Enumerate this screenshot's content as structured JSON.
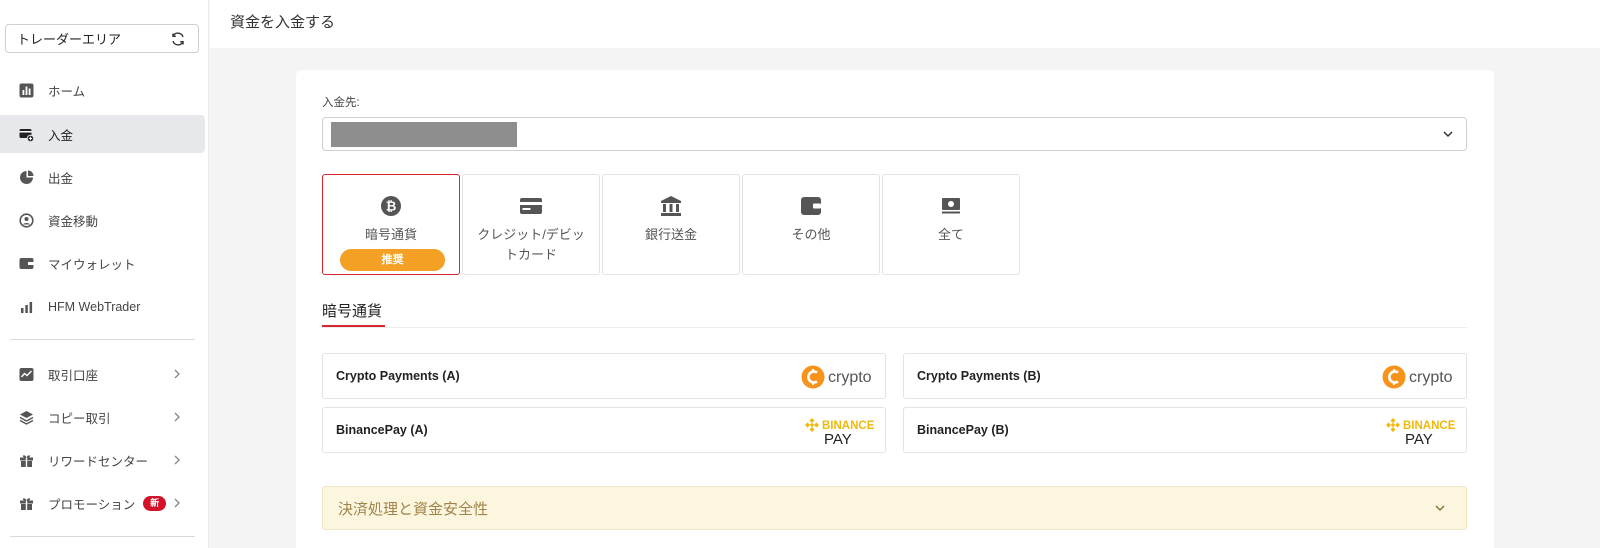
{
  "sidebar": {
    "area_select": "トレーダーエリア",
    "items": [
      {
        "label": "ホーム",
        "icon": "chart-icon"
      },
      {
        "label": "入金",
        "icon": "deposit-icon"
      },
      {
        "label": "出金",
        "icon": "withdraw-icon"
      },
      {
        "label": "資金移動",
        "icon": "transfer-icon"
      },
      {
        "label": "マイウォレット",
        "icon": "wallet-icon"
      },
      {
        "label": "HFM WebTrader",
        "icon": "bar-chart-icon"
      }
    ],
    "items2": [
      {
        "label": "取引口座",
        "icon": "trading-chart-icon"
      },
      {
        "label": "コピー取引",
        "icon": "layers-icon"
      },
      {
        "label": "リワードセンター",
        "icon": "gift-icon"
      },
      {
        "label": "プロモーション",
        "icon": "gift-icon",
        "badge": "新"
      }
    ]
  },
  "header": {
    "title": "資金を入金する"
  },
  "main": {
    "dest_label": "入金先:",
    "methods": [
      {
        "label": "暗号通貨",
        "icon": "bitcoin-icon",
        "badge": "推奨"
      },
      {
        "label": "クレジット/デビッ\nトカード",
        "icon": "credit-card-icon"
      },
      {
        "label": "銀行送金",
        "icon": "bank-icon"
      },
      {
        "label": "その他",
        "icon": "wallet-icon"
      },
      {
        "label": "全て",
        "icon": "cash-icon"
      }
    ],
    "section_title": "暗号通貨",
    "payments": [
      {
        "name": "Crypto Payments (A)",
        "logo": "crypto"
      },
      {
        "name": "Crypto Payments (B)",
        "logo": "crypto"
      },
      {
        "name": "BinancePay (A)",
        "logo_top": "BINANCE",
        "logo_bottom": "PAY"
      },
      {
        "name": "BinancePay (B)",
        "logo_top": "BINANCE",
        "logo_bottom": "PAY"
      }
    ],
    "accordion_title": "決済処理と資金安全性"
  },
  "colors": {
    "accent_red": "#d8262e",
    "badge_orange": "#f4a024",
    "binance_yellow": "#f0b90b",
    "crypto_orange": "#f7931a"
  }
}
